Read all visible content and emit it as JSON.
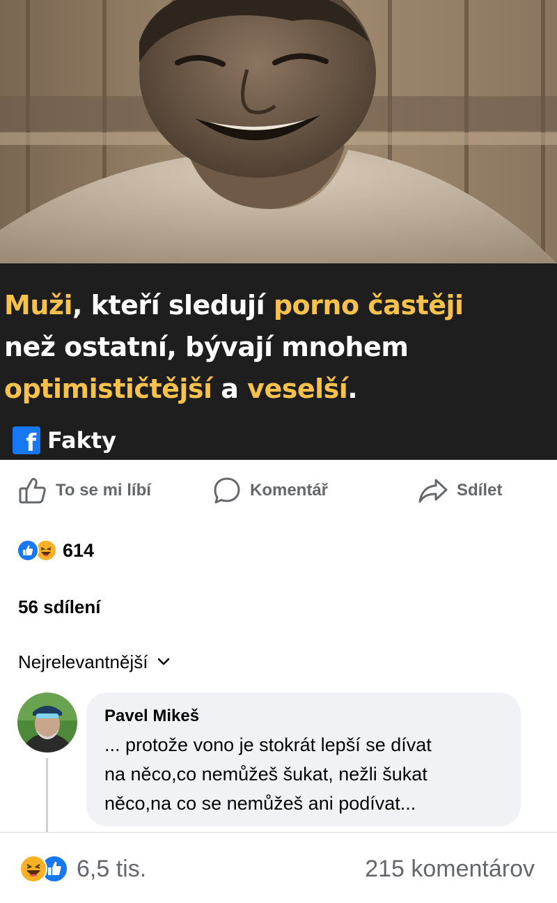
{
  "post": {
    "caption": {
      "line1": {
        "word1": "Muži",
        "text1": ", kteří sledují ",
        "highlight": "porno častěji"
      },
      "line2": "než ostatní, bývají mnohem",
      "line3": {
        "highlight1": "optimističtější",
        "text": " a ",
        "highlight2": "veselší",
        "end": "."
      }
    },
    "brand": {
      "icon": "facebook-icon",
      "name": "Fakty"
    },
    "image": {
      "description_icon": "smiling-man-photo"
    }
  },
  "actions": {
    "like_label": "To se mi líbí",
    "comment_label": "Komentář",
    "share_label": "Sdílet"
  },
  "reactions": {
    "count": "614",
    "types": [
      "like-icon",
      "haha-icon"
    ]
  },
  "shares": "56 sdílení",
  "sort": {
    "label": "Nejrelevantnější"
  },
  "comment": {
    "author": "Pavel Mikeš",
    "text": "... protože vono je stokrát lepší se dívat\nna něco,co nemůžeš šukat, nežli šukat\nněco,na co se nemůžeš ani podívat..."
  },
  "bottom_bar": {
    "reaction_count": "6,5 tis.",
    "comments_count": "215 komentárov"
  },
  "colors": {
    "accent": "#1877f2",
    "caption_highlight": "#f6c24b",
    "caption_bg": "#1e1e1e",
    "muted": "#65676b",
    "bubble": "#f0f2f5"
  }
}
